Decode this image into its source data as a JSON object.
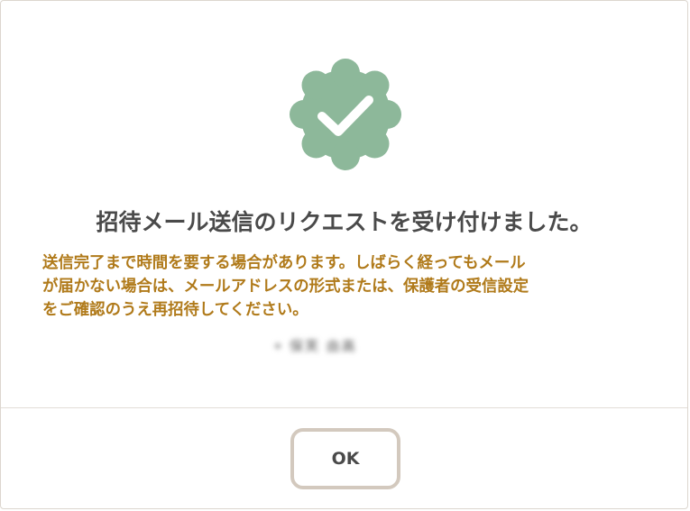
{
  "dialog": {
    "icon": "check-badge-icon",
    "title": "招待メール送信のリクエストを受け付けました。",
    "message": "送信完了まで時間を要する場合があります。しばらく経ってもメール\nが届かない場合は、メールアドレスの形式または、保護者の受信設定\nをご確認のうえ再招待してください。",
    "recipient": {
      "bullet": "•",
      "name": "保芙 由高"
    },
    "ok_label": "OK"
  },
  "colors": {
    "badge": "#8db89a",
    "message": "#b07a1a",
    "title": "#4a4a4a",
    "button_border": "#d3c9be"
  }
}
